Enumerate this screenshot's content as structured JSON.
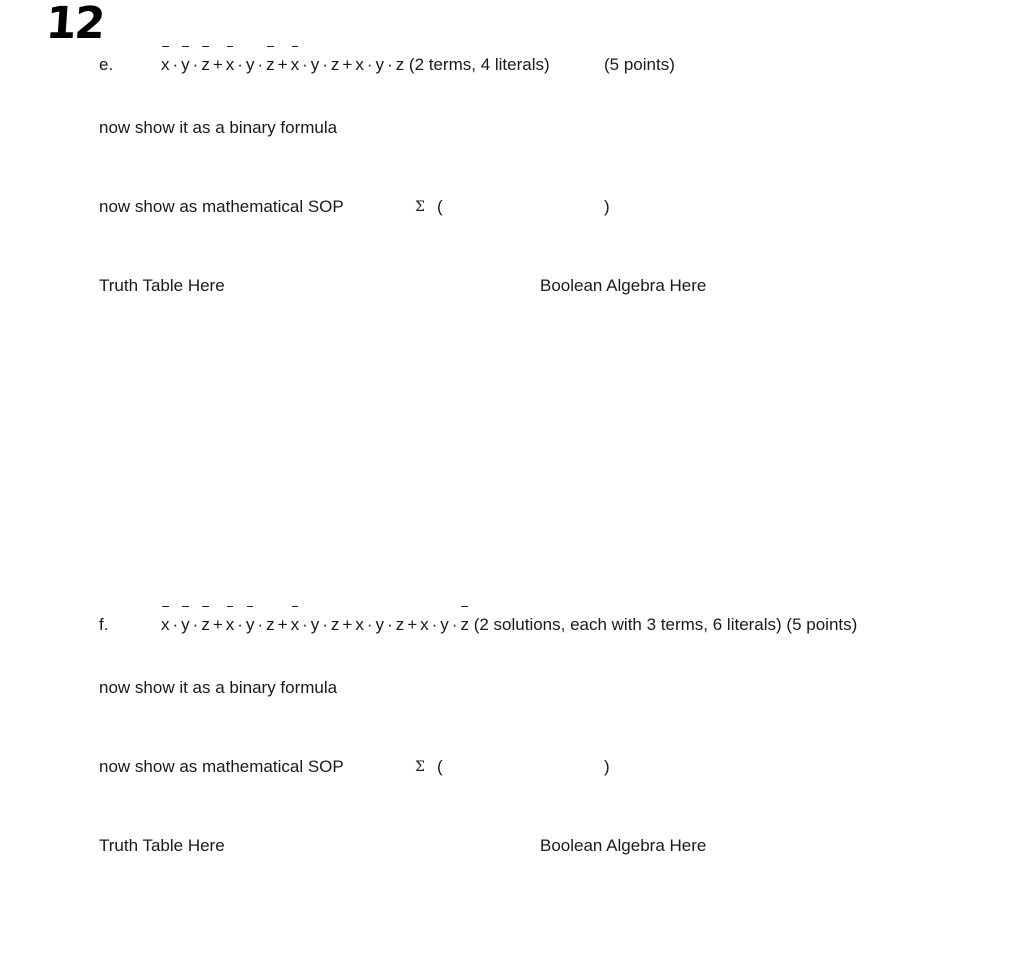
{
  "page_number_handwritten": "12",
  "problems": [
    {
      "label": "e.",
      "terms": [
        [
          {
            "v": "x",
            "bar": true
          },
          {
            "v": "y",
            "bar": true
          },
          {
            "v": "z",
            "bar": true
          }
        ],
        [
          {
            "v": "x",
            "bar": true
          },
          {
            "v": "y",
            "bar": false
          },
          {
            "v": "z",
            "bar": true
          }
        ],
        [
          {
            "v": "x",
            "bar": true
          },
          {
            "v": "y",
            "bar": false
          },
          {
            "v": "z",
            "bar": false
          }
        ],
        [
          {
            "v": "x",
            "bar": false
          },
          {
            "v": "y",
            "bar": false
          },
          {
            "v": "z",
            "bar": false
          }
        ]
      ],
      "note": "(2 terms, 4 literals)",
      "points": "(5 points)",
      "binary_prompt": "now show it as a binary formula",
      "sop_prompt": "now show as mathematical SOP",
      "sigma": "Σ",
      "open_paren": "(",
      "close_paren": ")",
      "truth_table_label": "Truth Table Here",
      "boolean_label": "Boolean Algebra Here"
    },
    {
      "label": "f.",
      "terms": [
        [
          {
            "v": "x",
            "bar": true
          },
          {
            "v": "y",
            "bar": true
          },
          {
            "v": "z",
            "bar": true
          }
        ],
        [
          {
            "v": "x",
            "bar": true
          },
          {
            "v": "y",
            "bar": true
          },
          {
            "v": "z",
            "bar": false
          }
        ],
        [
          {
            "v": "x",
            "bar": true
          },
          {
            "v": "y",
            "bar": false
          },
          {
            "v": "z",
            "bar": false
          }
        ],
        [
          {
            "v": "x",
            "bar": false
          },
          {
            "v": "y",
            "bar": false
          },
          {
            "v": "z",
            "bar": false
          }
        ],
        [
          {
            "v": "x",
            "bar": false
          },
          {
            "v": "y",
            "bar": false
          },
          {
            "v": "z",
            "bar": true
          }
        ]
      ],
      "note": "(2 solutions, each with 3 terms, 6 literals) (5 points)",
      "points": "",
      "binary_prompt": "now show it as a binary formula",
      "sop_prompt": "now show as mathematical SOP",
      "sigma": "Σ",
      "open_paren": "(",
      "close_paren": ")",
      "truth_table_label": "Truth Table Here",
      "boolean_label": "Boolean Algebra Here"
    }
  ]
}
